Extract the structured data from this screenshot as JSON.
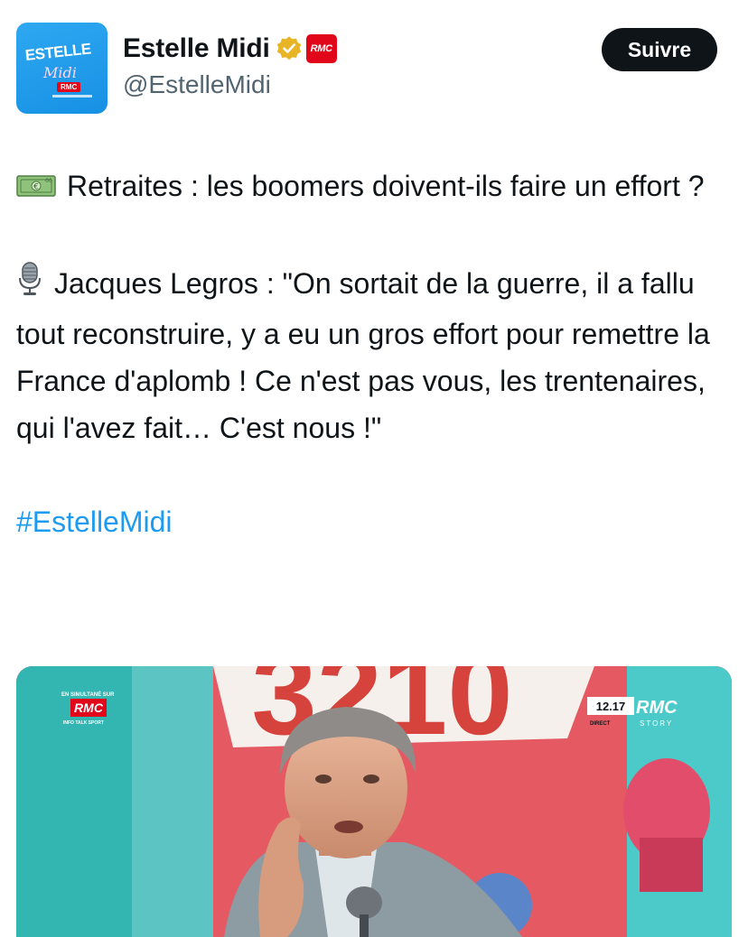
{
  "account": {
    "display_name": "Estelle Midi",
    "handle": "@EstelleMidi",
    "avatar_text": {
      "title": "ESTELLE",
      "subtitle": "Midi",
      "brand": "RMC"
    },
    "affiliate_badge_text": "RMC"
  },
  "follow_button": {
    "label": "Suivre"
  },
  "tweet": {
    "line1_emoji": "money-banknote-icon",
    "line1_text": "Retraites : les boomers doivent-ils faire un effort ?",
    "line2_emoji": "microphone-icon",
    "line2_text": "Jacques Legros : \"On sortait de la guerre, il a fallu tout reconstruire, y a eu un gros effort pour remettre la France d'aplomb ! Ce n'est pas vous, les trentenaires, qui l'avez fait… C'est nous !\"",
    "hashtag": "#EstelleMidi"
  },
  "media": {
    "overlay_left_top": "EN SIMULTANÉ SUR",
    "overlay_left_brand": "RMC",
    "overlay_left_sub": "INFO TALK SPORT",
    "overlay_time": "12.17",
    "overlay_right_brand": "RMC",
    "overlay_right_direct": "DIRECT",
    "overlay_right_story": "STORY",
    "backdrop_text": "3210"
  },
  "colors": {
    "text": "#0f1419",
    "secondary": "#536471",
    "link": "#1d9bf0",
    "button_bg": "#0f1419",
    "rmc_red": "#e2061b",
    "verified_gold": "#e8b526"
  }
}
